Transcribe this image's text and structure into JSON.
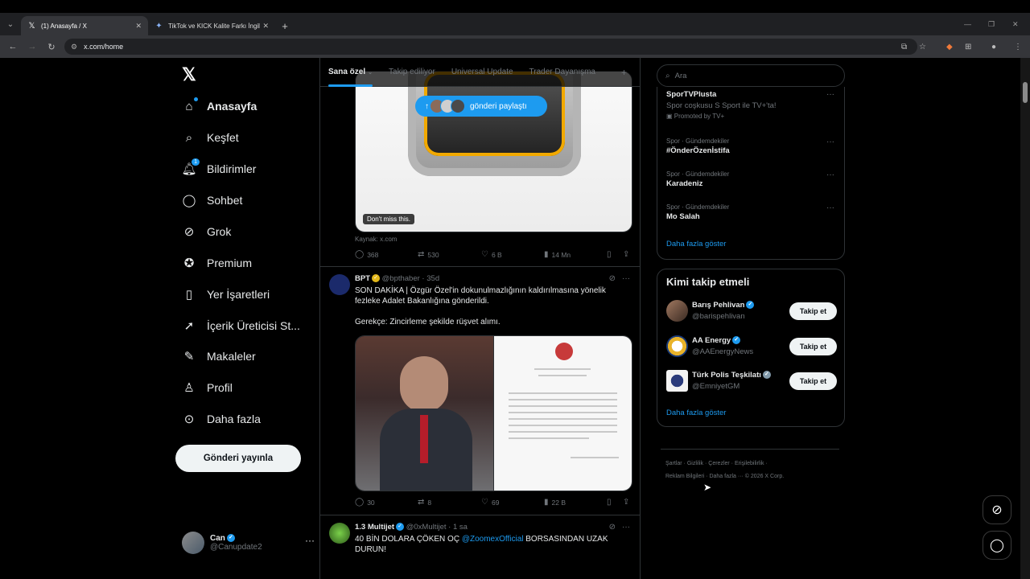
{
  "browser": {
    "tabs": [
      {
        "title": "(1) Anasayfa / X",
        "icon": "x-favicon"
      },
      {
        "title": "TikTok ve KICK Kalite Farkı İngil",
        "icon": "ai-favicon"
      }
    ],
    "url": "x.com/home"
  },
  "nav": {
    "logo": "𝕏",
    "items": [
      {
        "label": "Anasayfa",
        "icon": "home-icon"
      },
      {
        "label": "Keşfet",
        "icon": "search-icon"
      },
      {
        "label": "Bildirimler",
        "icon": "bell-icon",
        "badge": "1"
      },
      {
        "label": "Sohbet",
        "icon": "chat-icon"
      },
      {
        "label": "Grok",
        "icon": "grok-icon"
      },
      {
        "label": "Premium",
        "icon": "premium-icon"
      },
      {
        "label": "Yer İşaretleri",
        "icon": "bookmark-icon"
      },
      {
        "label": "İçerik Üreticisi St...",
        "icon": "rocket-icon"
      },
      {
        "label": "Makaleler",
        "icon": "article-icon"
      },
      {
        "label": "Profil",
        "icon": "person-icon"
      },
      {
        "label": "Daha fazla",
        "icon": "more-circle-icon"
      }
    ],
    "post_button": "Gönderi yayınla",
    "account": {
      "name": "Can",
      "handle": "@Canupdate2"
    }
  },
  "feed": {
    "tabs": [
      {
        "label": "Sana özel"
      },
      {
        "label": "Takip ediliyor"
      },
      {
        "label": "Universal Update"
      },
      {
        "label": "Trader Dayanışma"
      }
    ],
    "share_pill": "gönderi paylaştı",
    "post1": {
      "badge": "Don't miss this.",
      "source": "Kaynak: x.com",
      "replies": "368",
      "reposts": "530",
      "likes": "6 B",
      "views": "14 Mn"
    },
    "post2": {
      "name": "BPT",
      "handle": "@bpthaber",
      "time": "35d",
      "line1": "SON DAKİKA | Özgür Özel'in dokunulmazlığının kaldırılmasına yönelik",
      "line2": "fezleke Adalet Bakanlığına gönderildi.",
      "line3": "Gerekçe: Zincirleme şekilde rüşvet alımı.",
      "replies": "30",
      "reposts": "8",
      "likes": "69",
      "views": "22 B"
    },
    "post3": {
      "name": "1.3 Multijet",
      "handle": "@0xMultijet",
      "time": "1 sa",
      "text_a": "40 BİN DOLARA ÇÖKEN OÇ ",
      "mention": "@ZoomexOfficial",
      "text_b": " BORSASINDAN UZAK",
      "line2": "DURUN!"
    }
  },
  "sidebar": {
    "search_placeholder": "Ara",
    "trends": [
      {
        "title": "SporTVPlusta",
        "sub": "Spor coşkusu S Sport ile TV+'ta!",
        "promo": "Promoted by TV+"
      },
      {
        "meta": "Spor · Gündemdekiler",
        "title": "#ÖnderÖzenİstifa"
      },
      {
        "meta": "Spor · Gündemdekiler",
        "title": "Karadeniz"
      },
      {
        "meta": "Spor · Gündemdekiler",
        "title": "Mo Salah"
      }
    ],
    "show_more": "Daha fazla göster",
    "who_title": "Kimi takip etmeli",
    "who": [
      {
        "name": "Barış Pehlivan",
        "handle": "@barispehlivan",
        "btn": "Takip et"
      },
      {
        "name": "AA Energy",
        "handle": "@AAEnergyNews",
        "btn": "Takip et"
      },
      {
        "name": "Türk Polis Teşkilatı",
        "handle": "@EmniyetGM",
        "btn": "Takip et"
      }
    ],
    "show_more2": "Daha fazla göster",
    "footer1": "Şartlar  ·   Gizlilik  ·   Çerezler  ·   Erişilebilirlik  ·",
    "footer2": "Reklam Bilgileri  ·   Daha fazla ···   © 2026 X Corp."
  },
  "colors": {
    "accent": "#1d9bf0",
    "background": "#000000",
    "border": "#2f3336",
    "muted": "#71767b"
  }
}
